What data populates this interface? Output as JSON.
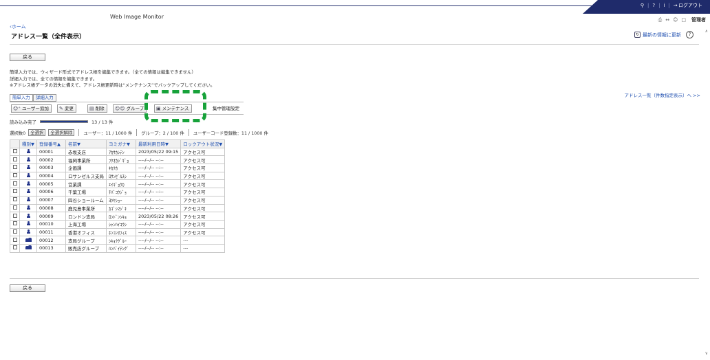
{
  "header": {
    "app_title": "Web Image Monitor",
    "search_icon": "search-icon",
    "help_label": "?",
    "info_label": "i",
    "logout_label": "ログアウト",
    "admin_label": "管理者"
  },
  "nav": {
    "home_link": "‹ホーム"
  },
  "page": {
    "title": "アドレス一覧（全件表示）",
    "refresh_label": "最新の情報に更新",
    "help_label": "?",
    "back_label": "戻る",
    "desc1": "簡単入力では、ウィザード形式でアドレス帳を編集できます。（全ての情報は編集できません）",
    "desc2": "詳細入力では、全ての情報を編集できます。",
    "desc3": "※アドレス帳データの消失に備えて、アドレス帳更新時は“メンテナンス”でバックアップしてください。",
    "address_list_link": "アドレス一覧（件数指定表示）へ >>"
  },
  "tabs": [
    {
      "label": "簡単入力"
    },
    {
      "label": "詳細入力"
    }
  ],
  "toolbar": {
    "add_user": "ユーザー追加",
    "edit": "変更",
    "delete": "削除",
    "group": "グループ",
    "maintenance": "メンテナンス",
    "central": "集中管理設定"
  },
  "load": {
    "label": "読み込み完了",
    "count": "13 / 13 件",
    "progress": 1.0
  },
  "selection": {
    "selected": "選択数0",
    "select_all": "全選択",
    "deselect_all": "全選択解除",
    "users": "ユーザー：11 / 1000 件",
    "groups": "グループ：2 / 100 件",
    "user_codes": "ユーザーコード登録数：11 / 1000 件"
  },
  "table": {
    "headers": [
      "種別▼",
      "登録番号▲",
      "名前▼",
      "ヨミガナ▼",
      "最新利用日時▼",
      "ロックアウト状況▼"
    ],
    "rows": [
      {
        "type": "user",
        "reg": "00001",
        "name": "赤坂支店",
        "furi": "ｱｶｻｶｼﾃﾝ",
        "last": "2023/05/22 09:15",
        "lock": "アクセス可"
      },
      {
        "type": "user",
        "reg": "00002",
        "name": "福岡事業所",
        "furi": "ﾌｸｵｶｼﾞｷﾞｮ",
        "last": "----/--/-- --:--",
        "lock": "アクセス可"
      },
      {
        "type": "user",
        "reg": "00003",
        "name": "企画課",
        "furi": "ｷｶｸｶ",
        "last": "----/--/-- --:--",
        "lock": "アクセス可"
      },
      {
        "type": "user",
        "reg": "00004",
        "name": "ロサンゼルス支局",
        "furi": "ﾛｻﾝｾﾞﾙｽｼ",
        "last": "----/--/-- --:--",
        "lock": "アクセス可"
      },
      {
        "type": "user",
        "reg": "00005",
        "name": "営業課",
        "furi": "ｴｲｷﾞｮｳｶ",
        "last": "----/--/-- --:--",
        "lock": "アクセス可"
      },
      {
        "type": "user",
        "reg": "00006",
        "name": "千葉工場",
        "furi": "ﾁﾊﾞｺｳｼﾞｮ",
        "last": "----/--/-- --:--",
        "lock": "アクセス可"
      },
      {
        "type": "user",
        "reg": "00007",
        "name": "四谷ショールーム",
        "furi": "ﾖﾂﾔｼｮｰ",
        "last": "----/--/-- --:--",
        "lock": "アクセス可"
      },
      {
        "type": "user",
        "reg": "00008",
        "name": "鹿児島事業所",
        "furi": "ｶｺﾞｼﾏｼﾞｷ",
        "last": "----/--/-- --:--",
        "lock": "アクセス可"
      },
      {
        "type": "user",
        "reg": "00009",
        "name": "ロンドン支局",
        "furi": "ﾛﾝﾄﾞﾝｼｷｮ",
        "last": "2023/05/22 08:26",
        "lock": "アクセス可"
      },
      {
        "type": "user",
        "reg": "00010",
        "name": "上海工場",
        "furi": "ｼｬﾝﾊｲｺｳｼ",
        "last": "----/--/-- --:--",
        "lock": "アクセス可"
      },
      {
        "type": "user",
        "reg": "00011",
        "name": "香港オフィス",
        "furi": "ﾎﾝｺﾝｵﾌｨｽ",
        "last": "----/--/-- --:--",
        "lock": "アクセス可"
      },
      {
        "type": "group",
        "reg": "00012",
        "name": "支局グループ",
        "furi": "ｼｷｮｸｸﾞﾙｰ",
        "last": "----/--/-- --:--",
        "lock": "---"
      },
      {
        "type": "group",
        "reg": "00013",
        "name": "販売店グループ",
        "furi": "ﾊﾝﾊﾞｲﾃﾝｸﾞ",
        "last": "----/--/-- --:--",
        "lock": "---"
      }
    ]
  },
  "colors": {
    "brand_bar": "#1f2b6b",
    "highlight": "#17a23a",
    "link": "#2050b0"
  }
}
